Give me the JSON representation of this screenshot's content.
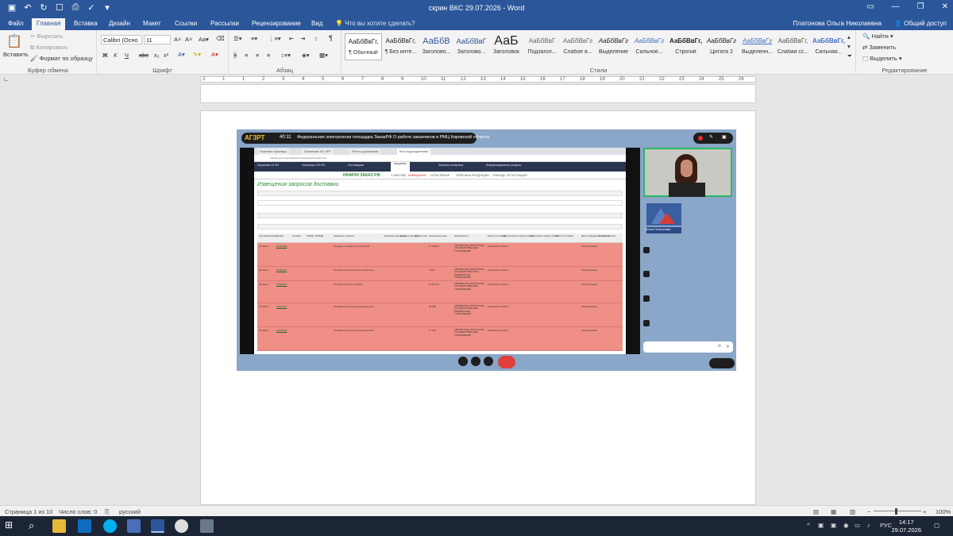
{
  "window": {
    "title": "скрин ВКС 29.07.2026 - Word",
    "qat_icons": [
      "save-icon",
      "undo-icon",
      "redo-icon",
      "touch-mode-icon",
      "print-preview-icon",
      "spelling-icon",
      "customize-icon"
    ]
  },
  "tabs": [
    "Файл",
    "Главная",
    "Вставка",
    "Дизайн",
    "Макет",
    "Ссылки",
    "Рассылки",
    "Рецензирование",
    "Вид"
  ],
  "active_tab": "Главная",
  "tell_me": "Что вы хотите сделать?",
  "user": "Платонова Ольга Николаевна",
  "share": "Общий доступ",
  "ribbon": {
    "clipboard": {
      "paste": "Вставить",
      "cut": "Вырезать",
      "copy": "Копировать",
      "format_painter": "Формат по образцу",
      "label": "Буфер обмена"
    },
    "font": {
      "family": "Calibri (Осно",
      "size": "11",
      "label": "Шрифт",
      "bold": "Ж",
      "italic": "К",
      "underline": "Ч",
      "strike": "abc",
      "sub": "x₂",
      "sup": "x²"
    },
    "paragraph": {
      "label": "Абзац",
      "pilcrow": "¶"
    },
    "styles": {
      "label": "Стили",
      "items": [
        {
          "sample": "АаБбВвГг,",
          "name": "¶ Обычный"
        },
        {
          "sample": "АаБбВвГг,",
          "name": "¶ Без инте..."
        },
        {
          "sample": "АаБбВ",
          "name": "Заголово..."
        },
        {
          "sample": "АаБбВвГ",
          "name": "Заголово..."
        },
        {
          "sample": "АаБ",
          "name": "Заголовок"
        },
        {
          "sample": "АаБбВвГ",
          "name": "Подзагол..."
        },
        {
          "sample": "АаБбВвГг",
          "name": "Слабое в..."
        },
        {
          "sample": "АаБбВвГг",
          "name": "Выделение"
        },
        {
          "sample": "АаБбВвГг",
          "name": "Сильное..."
        },
        {
          "sample": "АаБбВвГг,",
          "name": "Строгий"
        },
        {
          "sample": "АаБбВвГг",
          "name": "Цитата 2"
        },
        {
          "sample": "АаБбВвГг",
          "name": "Выделенн..."
        },
        {
          "sample": "АаБбВвГг,",
          "name": "Слабая сс..."
        },
        {
          "sample": "АаБбВвГг,",
          "name": "Сильная..."
        }
      ]
    },
    "editing": {
      "find": "Найти",
      "replace": "Заменить",
      "select": "Выделить",
      "label": "Редактирование"
    }
  },
  "ruler_numbers": [
    "2",
    "1",
    "1",
    "2",
    "3",
    "4",
    "5",
    "6",
    "7",
    "8",
    "9",
    "10",
    "11",
    "12",
    "13",
    "14",
    "15",
    "16",
    "17",
    "18",
    "19",
    "20",
    "21",
    "22",
    "23",
    "24",
    "25",
    "26"
  ],
  "screenshot": {
    "logo": "АГЗРТ",
    "timer": "40:11",
    "conference_title": "Федеральная электронная площадка ЗаказРФ О работе заказчиков в РМЦ Кировской области",
    "browser_tabs": [
      "Главная страница",
      "Заказчики АО ЗРТ",
      "Реестр договоров",
      "Все подразделения"
    ],
    "address": "zakupki.gov.ru/epz/order/extendedsearch/results.html",
    "top_nav": [
      "Заказчики 44-ФЗ",
      "Заказчики 223-ФЗ",
      "Поставщики",
      "Аукционы",
      "Запросы котировок",
      "Информационные ресурсы"
    ],
    "site_logo": "ЮНИОН ЗАКАЗ РФ",
    "site_nav": [
      "О ЗАКУПКЕ",
      "ИЗВЕЩЕНИЯ",
      "ОТРАСЛЕВЫЕ",
      "ПЕРЕЧЕНЬ ПРОДУКЦИИ",
      "ПОМОЩЬ",
      "РЕГИСТРАЦИЯ"
    ],
    "heading": "Извещения запросов доставки",
    "table_headers": [
      "Торговый режим",
      "Номер",
      "Артикул",
      "ОКПД / ОКВЭД",
      "Название позиции",
      "Единица измерения",
      "Цена за единицу",
      "Количество",
      "Начальная цена",
      "Организатор",
      "Регион поставки",
      "Дата начала подачи заявок",
      "Окончание подачи заявок",
      "Место поставки",
      "Дата проведения закупки",
      "Статус закупки"
    ],
    "rows": [
      {
        "mode": "44 закон",
        "number": "20256389",
        "item": "Продукты питания для столовой",
        "price": "17 384,17",
        "org": "КИРОВСКОЕ ОБЛАСТНОЕ ГОСУДАРСТВЕННОЕ УЧРЕЖДЕНИЕ",
        "region": "Кировская область",
        "status": "Опубликовано"
      },
      {
        "mode": "44 закон",
        "number": "20256391",
        "item": "Поставка строительных материалов",
        "price": "1 698",
        "org": "КИРОВСКОЕ ОБЛАСТНОЕ ГОСУДАРСТВЕННОЕ БЮДЖЕТНОЕ УЧРЕЖДЕНИЕ",
        "region": "Кировская область",
        "status": "Опубликовано"
      },
      {
        "mode": "44 закон",
        "number": "20256394",
        "item": "Поставка электротоваров",
        "price": "11 874,00",
        "org": "КИРОВСКОЕ ОБЛАСТНОЕ ГОСУДАРСТВЕННОЕ УЧРЕЖДЕНИЕ",
        "region": "Кировская область",
        "status": "Опубликовано"
      },
      {
        "mode": "44 закон",
        "number": "20256397",
        "item": "Поставка строительных материалов",
        "price": "28 860",
        "org": "КИРОВСКОЕ ОБЛАСТНОЕ ГОСУДАРСТВЕННОЕ БЮДЖЕТНОЕ УЧРЕЖДЕНИЕ",
        "region": "Кировская область",
        "status": "Опубликовано"
      },
      {
        "mode": "44 закон",
        "number": "20256399",
        "item": "Поставка строительных материалов",
        "price": "17 879",
        "org": "КИРОВСКОЕ ОБЛАСТНОЕ ГОСУДАРСТВЕННОЕ УЧРЕЖДЕНИЕ",
        "region": "Кировская область",
        "status": "Опубликовано"
      }
    ],
    "participant_tile": "Ольга Платонова"
  },
  "status_bar": {
    "page": "Страница 1 из 10",
    "words": "Число слов: 0",
    "language": "русский",
    "zoom": "100%"
  },
  "taskbar": {
    "lang": "РУС",
    "time": "14:17",
    "date": "29.07.2026"
  },
  "colors": {
    "word_blue": "#2b579a",
    "row_red": "#ef8f85",
    "cam_border": "#2bb860",
    "hangup": "#e0403a"
  }
}
